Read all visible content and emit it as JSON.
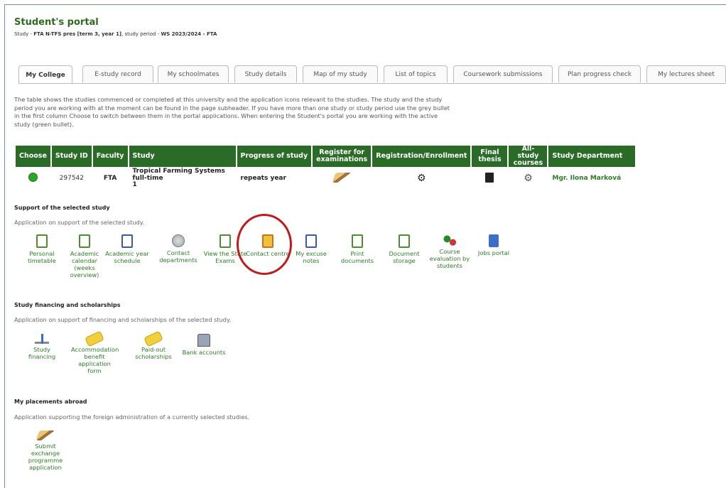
{
  "header": {
    "title": "Student's portal",
    "subtitle_prefix": "Study - ",
    "subtitle_study": "FTA N-TFS pres [term 3, year 1]",
    "subtitle_mid": ", study period - ",
    "subtitle_period": "WS 2023/2024 - FTA"
  },
  "tabs": [
    {
      "label": "My College",
      "active": true
    },
    {
      "label": "E-study record"
    },
    {
      "label": "My schoolmates"
    },
    {
      "label": "Study details"
    },
    {
      "label": "Map of my study"
    },
    {
      "label": "List of topics"
    },
    {
      "label": "Coursework submissions"
    },
    {
      "label": "Plan progress check"
    },
    {
      "label": "My lectures sheet"
    }
  ],
  "intro": "The table shows the studies commenced or completed at this university and the application icons relevant to the studies. The study and the study period you are working with at the moment can be found in the page subheader. If you have more than one study or study period use the grey bullet in the first column Choose to switch between them in the portal applications. When entering the Student's portal you are working with the active study (green bullet).",
  "table": {
    "headers": [
      "Choose",
      "Study ID",
      "Faculty",
      "Study",
      "Progress of study",
      "Register for examinations",
      "Registration/Enrollment",
      "Final thesis",
      "All-study courses",
      "Study Department"
    ],
    "row": {
      "study_id": "297542",
      "faculty": "FTA",
      "study_line1": "Tropical Farming Systems",
      "study_line2": "full-time",
      "study_line3": "1",
      "progress": "repeats year",
      "department": "Mgr. Ilona Marková"
    }
  },
  "support": {
    "heading": "Support of the selected study",
    "desc": "Application on support of the selected study.",
    "apps": [
      {
        "label": "Personal timetable",
        "icon": "timetable-icon"
      },
      {
        "label": "Academic calendar (weeks overview)",
        "icon": "calendar-icon"
      },
      {
        "label": "Academic year schedule",
        "icon": "schedule-icon"
      },
      {
        "label": "Contact departments",
        "icon": "contact-departments-icon"
      },
      {
        "label": "View the State Exams",
        "icon": "state-exams-icon"
      },
      {
        "label": "Contact centre",
        "icon": "contact-centre-icon"
      },
      {
        "label": "My excuse notes",
        "icon": "excuse-notes-icon"
      },
      {
        "label": "Print documents",
        "icon": "print-icon"
      },
      {
        "label": "Document storage",
        "icon": "document-storage-icon"
      },
      {
        "label": "Course evaluation by students",
        "icon": "evaluation-icon"
      },
      {
        "label": "Jobs portal",
        "icon": "jobs-icon"
      }
    ]
  },
  "financing": {
    "heading": "Study financing and scholarships",
    "desc": "Application on support of financing and scholarships of the selected study.",
    "apps": [
      {
        "label": "Study financing",
        "icon": "financing-icon"
      },
      {
        "label": "Accommodation benefit application form",
        "icon": "accommodation-icon"
      },
      {
        "label": "Paid-out scholarships",
        "icon": "scholarship-icon"
      },
      {
        "label": "Bank accounts",
        "icon": "bank-icon"
      }
    ]
  },
  "abroad": {
    "heading": "My placements abroad",
    "desc": "Application supporting the foreign administration of a currently selected studies.",
    "apps": [
      {
        "label": "Submit exchange programme application",
        "icon": "exchange-application-icon"
      }
    ]
  }
}
